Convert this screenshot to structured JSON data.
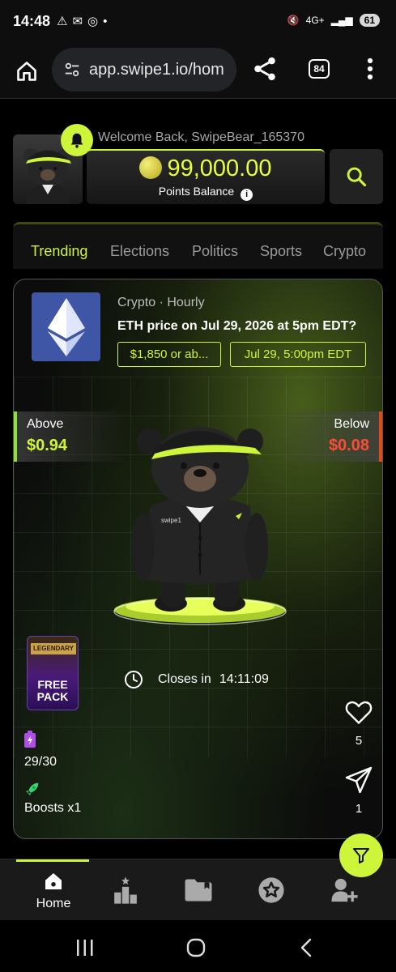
{
  "status_bar": {
    "time": "14:48",
    "network": "4G+",
    "battery": "61"
  },
  "browser": {
    "url": "app.swipe1.io/hom",
    "tab_count": "84"
  },
  "header": {
    "welcome": "Welcome Back, SwipeBear_165370",
    "points_value": "99,000.00",
    "points_label": "Points Balance"
  },
  "tabs": [
    {
      "label": "Trending",
      "active": true
    },
    {
      "label": "Elections",
      "active": false
    },
    {
      "label": "Politics",
      "active": false
    },
    {
      "label": "Sports",
      "active": false
    },
    {
      "label": "Crypto",
      "active": false
    }
  ],
  "card": {
    "meta": "Crypto · Hourly",
    "question": "ETH price on Jul 29, 2026 at 5pm EDT?",
    "chip_outcome": "$1,850 or ab...",
    "chip_time": "Jul 29, 5:00pm EDT",
    "above_label": "Above",
    "above_price": "$0.94",
    "below_label": "Below",
    "below_price": "$0.08",
    "bear_brand": "swipe1",
    "pack_top": "LEGENDARY",
    "pack_label_1": "FREE",
    "pack_label_2": "PACK",
    "closes_label": "Closes in",
    "closes_time": "14:11:09",
    "energy": "29/30",
    "boosts": "Boosts x1",
    "likes": "5",
    "shares": "1"
  },
  "bottom_nav": {
    "home_label": "Home"
  },
  "colors": {
    "accent": "#cdf53a",
    "above": "#cdf53a",
    "below": "#ff4a3a",
    "eth_tile": "#3f55a5"
  }
}
